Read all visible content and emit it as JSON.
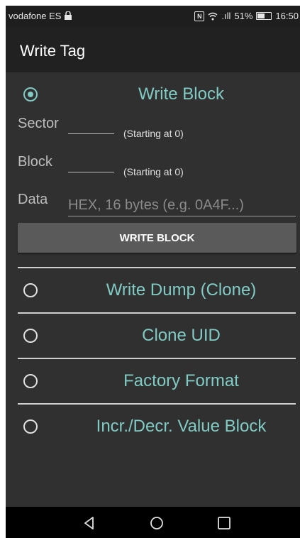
{
  "status_bar": {
    "carrier": "vodafone ES",
    "signal_text": ".ıll",
    "battery_percent": "51%",
    "time": "16:50",
    "icons": [
      "sim-lock-icon",
      "nfc-icon",
      "wifi-icon",
      "signal-icon",
      "battery-icon"
    ]
  },
  "toolbar": {
    "title": "Write Tag"
  },
  "options": [
    {
      "label": "Write Block",
      "selected": true
    },
    {
      "label": "Write Dump (Clone)",
      "selected": false
    },
    {
      "label": "Clone UID",
      "selected": false
    },
    {
      "label": "Factory Format",
      "selected": false
    },
    {
      "label": "Incr./Decr. Value Block",
      "selected": false
    }
  ],
  "write_block_form": {
    "sector_label": "Sector",
    "sector_value": "",
    "sector_hint": "(Starting at 0)",
    "block_label": "Block",
    "block_value": "",
    "block_hint": "(Starting at 0)",
    "data_label": "Data",
    "data_value": "",
    "data_placeholder": "HEX, 16 bytes (e.g. 0A4F...)",
    "button_label": "WRITE BLOCK"
  },
  "nav_bar": {
    "icons": [
      "back-icon",
      "home-icon",
      "recents-icon"
    ]
  },
  "colors": {
    "accent": "#80cbc4",
    "background": "#303030",
    "toolbar": "#212121",
    "status_bar": "#1e1e1e",
    "button": "#5a5a5a"
  }
}
